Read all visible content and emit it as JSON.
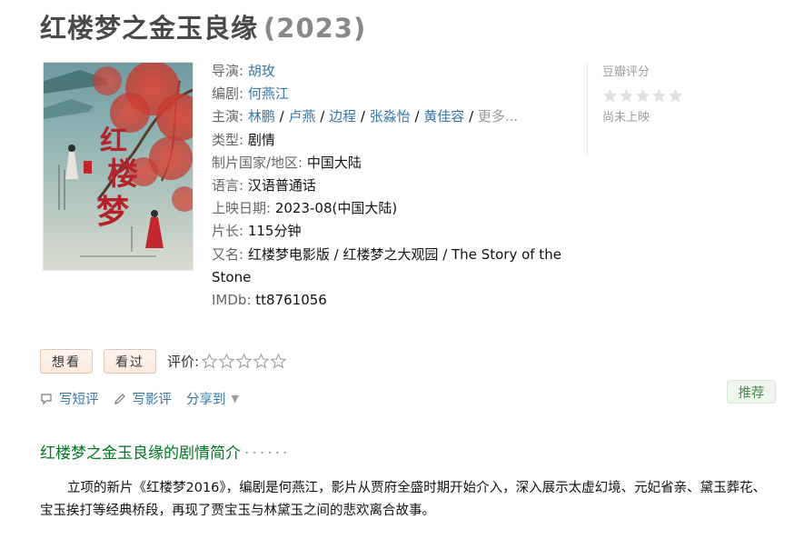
{
  "movie": {
    "title": "红楼梦之金玉良缘",
    "year": "(2023)"
  },
  "info": {
    "director_label": "导演:",
    "director": "胡玫",
    "writer_label": "编剧:",
    "writer": "何燕江",
    "cast_label": "主演:",
    "cast": [
      "林鹏",
      "卢燕",
      "边程",
      "张淼怡",
      "黄佳容"
    ],
    "cast_more": "更多...",
    "genre_label": "类型:",
    "genre": "剧情",
    "country_label": "制片国家/地区:",
    "country": "中国大陆",
    "language_label": "语言:",
    "language": "汉语普通话",
    "release_label": "上映日期:",
    "release": "2023-08(中国大陆)",
    "runtime_label": "片长:",
    "runtime": "115分钟",
    "aka_label": "又名:",
    "aka": "红楼梦电影版 / 红楼梦之大观园 / The Story of the Stone",
    "imdb_label": "IMDb:",
    "imdb": "tt8761056"
  },
  "rating": {
    "label": "豆瓣评分",
    "status": "尚未上映"
  },
  "actions": {
    "want": "想看",
    "seen": "看过",
    "rate_label": "评价:"
  },
  "tools": {
    "short_review": "写短评",
    "review": "写影评",
    "share": "分享到"
  },
  "recommend": "推荐",
  "summary": {
    "title": "红楼梦之金玉良缘的剧情简介",
    "dots": "······",
    "text": "立项的新片《红楼梦2016》，编剧是何燕江，影片从贾府全盛时期开始介入，深入展示太虚幻境、元妃省亲、黛玉葬花、宝玉挨打等经典桥段，再现了贾宝玉与林黛玉之间的悲欢离合故事。"
  },
  "colors": {
    "link": "#3377aa",
    "section_green": "#007722",
    "title_gray": "#494949"
  }
}
